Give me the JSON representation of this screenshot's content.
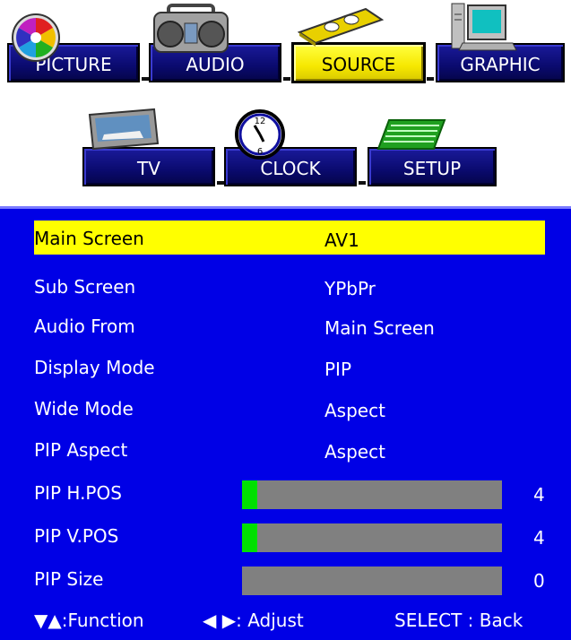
{
  "tabs": [
    {
      "label": "PICTURE",
      "icon": "color-wheel-icon",
      "active": false
    },
    {
      "label": "AUDIO",
      "icon": "boombox-icon",
      "active": false
    },
    {
      "label": "SOURCE",
      "icon": "vhs-tape-icon",
      "active": true
    },
    {
      "label": "GRAPHIC",
      "icon": "computer-icon",
      "active": false
    },
    {
      "label": "TV",
      "icon": "television-icon",
      "active": false
    },
    {
      "label": "CLOCK",
      "icon": "clock-icon",
      "active": false
    },
    {
      "label": "SETUP",
      "icon": "circuit-board-icon",
      "active": false
    }
  ],
  "menu": [
    {
      "label": "Main Screen",
      "value": "AV1",
      "selected": true
    },
    {
      "label": "Sub Screen",
      "value": "YPbPr"
    },
    {
      "label": "Audio From",
      "value": "Main Screen"
    },
    {
      "label": "Display Mode",
      "value": "PIP"
    },
    {
      "label": "Wide Mode",
      "value": "Aspect"
    },
    {
      "label": "PIP Aspect",
      "value": "Aspect"
    },
    {
      "label": "PIP H.POS",
      "slider_value": "4",
      "slider_fraction": 0.06
    },
    {
      "label": "PIP V.POS",
      "slider_value": "4",
      "slider_fraction": 0.06
    },
    {
      "label": "PIP Size",
      "slider_value": "0",
      "slider_fraction": 0
    }
  ],
  "footer": {
    "function_hint": "▼▲:Function",
    "adjust_hint": "◀ ▶: Adjust",
    "select_hint": "SELECT : Back"
  },
  "colors": {
    "panel": "#0000e6",
    "highlight": "#ffff00",
    "slider_fill": "#00e000",
    "slider_track": "#808080"
  }
}
